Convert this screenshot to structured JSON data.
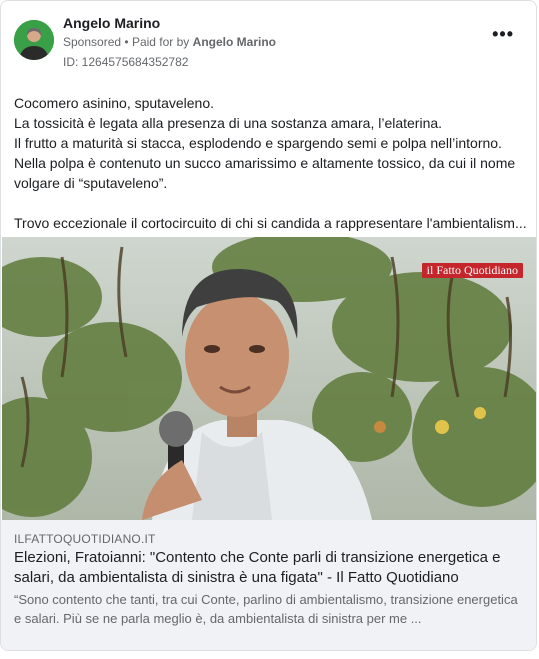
{
  "post": {
    "author": "Angelo Marino",
    "sponsored": "Sponsored",
    "paid_prefix": "Paid for by",
    "paid_by": "Angelo Marino",
    "id_label": "ID: 1264575684352782",
    "more_icon": "more-options-icon",
    "text": [
      "Cocomero asinino, sputaveleno.",
      "La tossicità è legata alla presenza di una sostanza amara, l’elaterina.",
      "Il frutto a maturità si stacca, esplodendo e spargendo semi e polpa nell’intorno.",
      "Nella polpa è contenuto un succo amarissimo e altamente tossico, da cui il nome",
      "volgare di “sputaveleno”.",
      "",
      "Trovo eccezionale il cortocircuito di chi si candida a rappresentare l'ambientalism..."
    ]
  },
  "media": {
    "watermark": "il Fatto Quotidiano"
  },
  "link": {
    "domain": "ILFATTOQUOTIDIANO.IT",
    "title": "Elezioni, Fratoianni: \"Contento che Conte parli di transizione energetica e salari, da ambientalista di sinistra è una figata\" - Il Fatto Quotidiano",
    "description": "“Sono contento che tanti, tra cui Conte, parlino di ambientalismo, transizione energetica e salari. Più se ne parla meglio è, da ambientalista di sinistra per me ..."
  }
}
